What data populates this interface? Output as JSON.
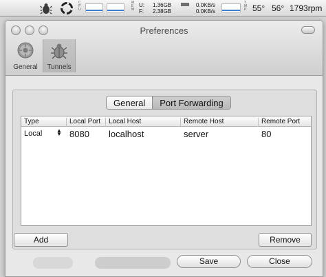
{
  "menubar": {
    "cpu_label": "CPU",
    "mem_label": "MEM",
    "mem_used_label": "U:",
    "mem_used": "1.36GB",
    "mem_free_label": "F:",
    "mem_free": "2.38GB",
    "net_up": "0.0KB/s",
    "net_down": "0.0KB/s",
    "net_label": "NET",
    "temp_label": "TMP",
    "temp1": "55°",
    "temp2": "56°",
    "fan": "1793rpm"
  },
  "window": {
    "title": "Preferences",
    "toolbar": [
      {
        "label": "General",
        "icon": "gear-icon"
      },
      {
        "label": "Tunnels",
        "icon": "bug-icon",
        "selected": true
      }
    ]
  },
  "tabs": [
    {
      "label": "General",
      "selected": false
    },
    {
      "label": "Port Forwarding",
      "selected": true
    }
  ],
  "table": {
    "columns": [
      "Type",
      "Local Port",
      "Local Host",
      "Remote Host",
      "Remote Port"
    ],
    "rows": [
      {
        "type": "Local",
        "local_port": "8080",
        "local_host": "localhost",
        "remote_host": "server",
        "remote_port": "80"
      }
    ]
  },
  "buttons": {
    "add": "Add",
    "remove": "Remove",
    "save": "Save",
    "close": "Close"
  }
}
